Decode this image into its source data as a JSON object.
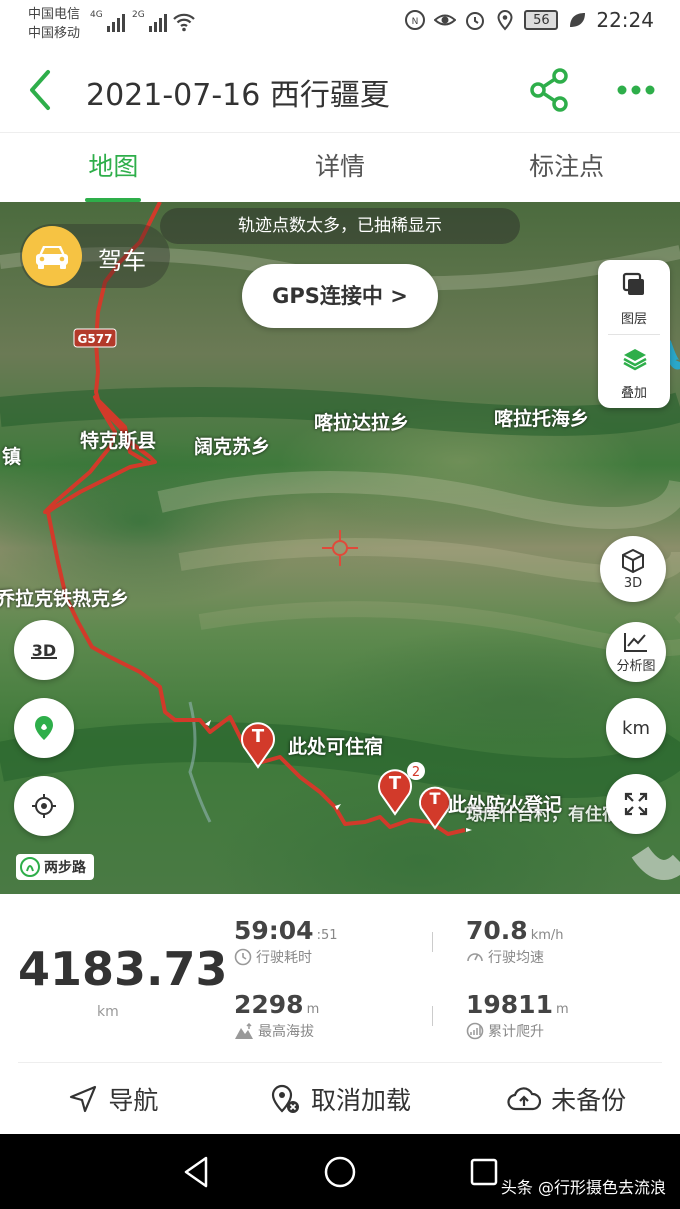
{
  "status_bar": {
    "carrier1": "中国电信",
    "carrier2": "中国移动",
    "net1": "4G",
    "net2": "2G",
    "battery": "56",
    "time": "22:24"
  },
  "header": {
    "title": "2021-07-16 西行疆夏"
  },
  "tabs": [
    {
      "label": "地图"
    },
    {
      "label": "详情"
    },
    {
      "label": "标注点"
    }
  ],
  "map": {
    "notice": "轨迹点数太多，已抽稀显示",
    "mode_label": "驾车",
    "gps_label": "GPS连接中 >",
    "layer_label": "图层",
    "overlay_label": "叠加",
    "btn_3d": "3D",
    "btn_analysis": "分析图",
    "btn_km": "km",
    "road_sign": "G577",
    "places": {
      "tekes": "特克斯县",
      "kuokesu": "阔克苏乡",
      "kaladala": "喀拉达拉乡",
      "kalatuohai": "喀拉托海乡",
      "zhen": "镇",
      "qiaolake": "乔拉克铁热克乡",
      "lodging": "此处可住宿",
      "fire": "此处防火登记",
      "village": "琼库什台村，有住宿"
    },
    "marker_badge": "2",
    "scale_badge": "两步路"
  },
  "stats": {
    "distance": "4183.73",
    "distance_unit": "km",
    "duration": "59:04",
    "duration_sec": ":51",
    "duration_label": "行驶耗时",
    "avg_speed": "70.8",
    "avg_speed_unit": "km/h",
    "avg_speed_label": "行驶均速",
    "max_alt": "2298",
    "max_alt_unit": "m",
    "max_alt_label": "最高海拔",
    "climb": "19811",
    "climb_unit": "m",
    "climb_label": "累计爬升"
  },
  "actions": {
    "navigate": "导航",
    "cancel_load": "取消加载",
    "backup": "未备份"
  },
  "watermark": "头条 @行形摄色去流浪"
}
